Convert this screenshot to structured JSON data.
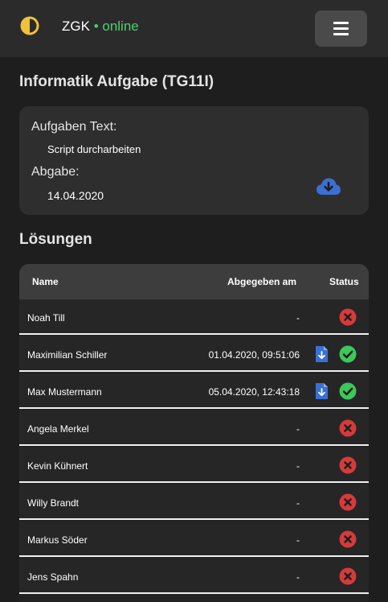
{
  "navbar": {
    "brand": "ZGK",
    "separator": "•",
    "status": "online",
    "icons": {
      "logo": "theme-toggle-icon",
      "menu": "hamburger-icon"
    }
  },
  "page": {
    "title": "Informatik Aufgabe (TG11I)"
  },
  "task": {
    "text_label": "Aufgaben Text:",
    "text_value": "Script durcharbeiten",
    "due_label": "Abgabe:",
    "due_value": "14.04.2020",
    "download_icon": "cloud-download-icon"
  },
  "solutions": {
    "title": "Lösungen",
    "columns": {
      "name": "Name",
      "submitted": "Abgegeben am",
      "status": "Status"
    },
    "rows": [
      {
        "name": "Noah Till",
        "submitted": "-",
        "has_file": false,
        "status": "missing"
      },
      {
        "name": "Maximilian Schiller",
        "submitted": "01.04.2020, 09:51:06",
        "has_file": true,
        "status": "done"
      },
      {
        "name": "Max Mustermann",
        "submitted": "05.04.2020, 12:43:18",
        "has_file": true,
        "status": "done"
      },
      {
        "name": "Angela Merkel",
        "submitted": "-",
        "has_file": false,
        "status": "missing"
      },
      {
        "name": "Kevin Kühnert",
        "submitted": "-",
        "has_file": false,
        "status": "missing"
      },
      {
        "name": "Willy Brandt",
        "submitted": "-",
        "has_file": false,
        "status": "missing"
      },
      {
        "name": "Markus Söder",
        "submitted": "-",
        "has_file": false,
        "status": "missing"
      },
      {
        "name": "Jens Spahn",
        "submitted": "-",
        "has_file": false,
        "status": "missing"
      }
    ]
  },
  "colors": {
    "accent_blue": "#3b6fd4",
    "success_green": "#3cc85a",
    "danger_red": "#d63a3a",
    "online_green": "#48d26b",
    "logo_yellow": "#f0c23c"
  }
}
